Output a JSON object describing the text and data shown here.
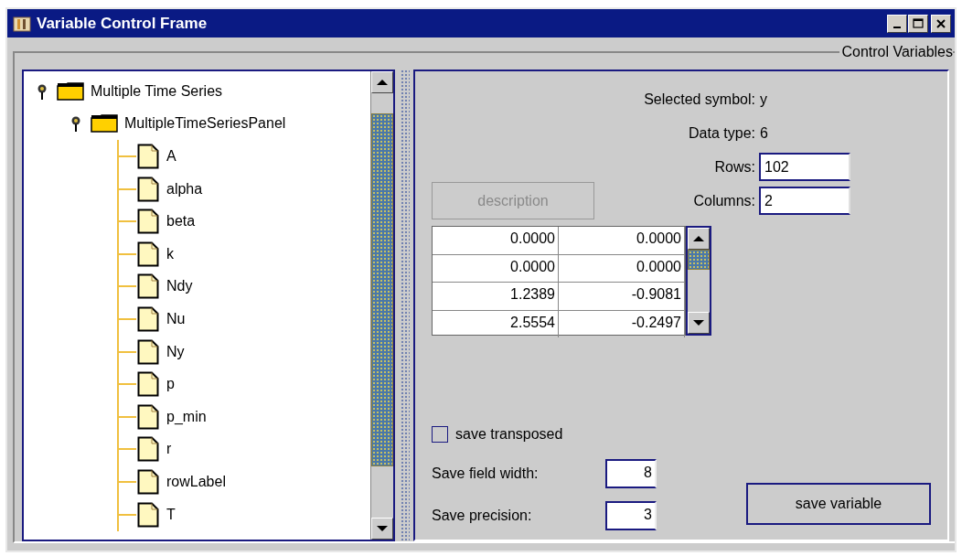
{
  "window": {
    "title": "Variable Control Frame"
  },
  "group_title": "Control Variables",
  "tree": [
    {
      "label": "Multiple Time Series",
      "expanded": true,
      "children": [
        {
          "label": "MultipleTimeSeriesPanel",
          "expanded": true,
          "children": [
            {
              "label": "A"
            },
            {
              "label": "alpha"
            },
            {
              "label": "beta"
            },
            {
              "label": "k"
            },
            {
              "label": "Ndy"
            },
            {
              "label": "Nu"
            },
            {
              "label": "Ny"
            },
            {
              "label": "p"
            },
            {
              "label": "p_min"
            },
            {
              "label": "r"
            },
            {
              "label": "rowLabel"
            },
            {
              "label": "T"
            }
          ]
        }
      ]
    }
  ],
  "details": [
    {
      "label": "Selected symbol:",
      "value": "y",
      "kind": "text"
    },
    {
      "label": "Data type:",
      "value": "6",
      "kind": "text"
    },
    {
      "label": "Rows:",
      "value": "102",
      "kind": "field"
    },
    {
      "label": "Columns:",
      "value": "2",
      "kind": "field"
    }
  ],
  "description_button": {
    "label": "description",
    "disabled": true
  },
  "data_table": {
    "rows": [
      [
        "0.0000",
        "0.0000"
      ],
      [
        "0.0000",
        "0.0000"
      ],
      [
        "1.2389",
        "-0.9081"
      ],
      [
        "2.5554",
        "-0.2497"
      ]
    ]
  },
  "save_transposed": {
    "label": "save transposed",
    "checked": false
  },
  "save_settings": [
    {
      "label": "Save field width:",
      "value": "8"
    },
    {
      "label": "Save precision:",
      "value": "3"
    }
  ],
  "save_button": {
    "label": "save variable"
  }
}
